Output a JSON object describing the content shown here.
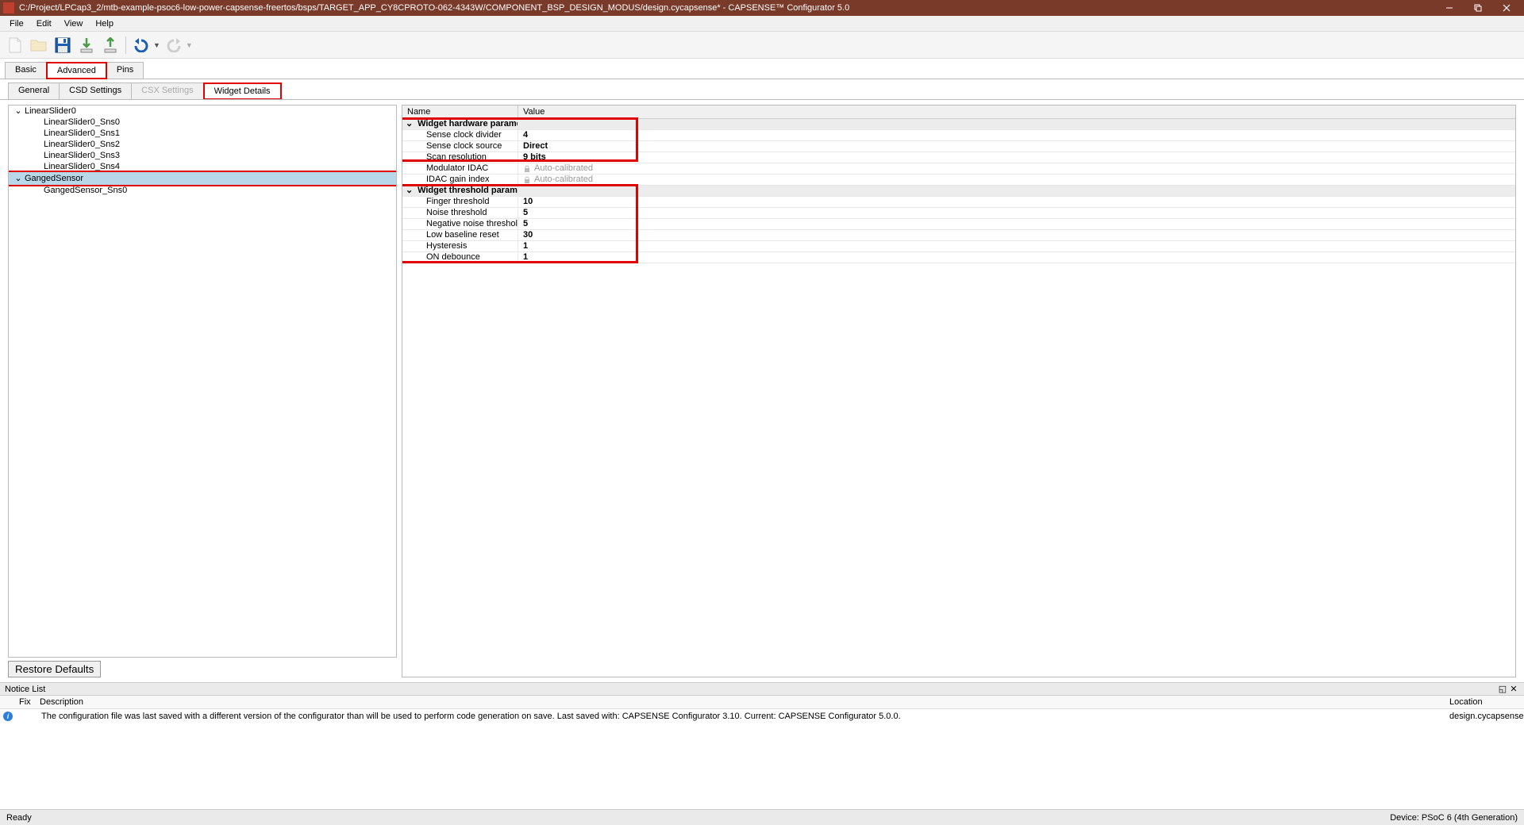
{
  "titlebar": {
    "path": "C:/Project/LPCap3_2/mtb-example-psoc6-low-power-capsense-freertos/bsps/TARGET_APP_CY8CPROTO-062-4343W/COMPONENT_BSP_DESIGN_MODUS/design.cycapsense* - CAPSENSE™ Configurator 5.0"
  },
  "menus": [
    "File",
    "Edit",
    "View",
    "Help"
  ],
  "main_tabs": {
    "items": [
      "Basic",
      "Advanced",
      "Pins"
    ],
    "active": 1,
    "highlight": 1
  },
  "sub_tabs": {
    "items": [
      "General",
      "CSD Settings",
      "CSX Settings",
      "Widget Details"
    ],
    "active": 3,
    "highlight": 3,
    "disabled": [
      2
    ]
  },
  "tree": {
    "nodes": [
      {
        "label": "LinearSlider0",
        "children": [
          "LinearSlider0_Sns0",
          "LinearSlider0_Sns1",
          "LinearSlider0_Sns2",
          "LinearSlider0_Sns3",
          "LinearSlider0_Sns4"
        ]
      },
      {
        "label": "GangedSensor",
        "selected": true,
        "children": [
          "GangedSensor_Sns0"
        ]
      }
    ]
  },
  "restore_label": "Restore Defaults",
  "param_header": {
    "name": "Name",
    "value": "Value"
  },
  "groups": [
    {
      "title": "Widget hardware parameters",
      "highlight": "top3",
      "rows": [
        {
          "name": "Sense clock divider",
          "value": "4",
          "bold": true
        },
        {
          "name": "Sense clock source",
          "value": "Direct",
          "bold": true
        },
        {
          "name": "Scan resolution",
          "value": "9 bits",
          "bold": true
        },
        {
          "name": "Modulator IDAC",
          "value": "Auto-calibrated",
          "muted": true,
          "lock": true
        },
        {
          "name": "IDAC gain index",
          "value": "Auto-calibrated",
          "muted": true,
          "lock": true
        }
      ]
    },
    {
      "title": "Widget threshold parameters",
      "highlight": "all",
      "rows": [
        {
          "name": "Finger threshold",
          "value": "10",
          "bold": true
        },
        {
          "name": "Noise threshold",
          "value": "5",
          "bold": true
        },
        {
          "name": "Negative noise threshold",
          "value": "5",
          "bold": true
        },
        {
          "name": "Low baseline reset",
          "value": "30",
          "bold": true
        },
        {
          "name": "Hysteresis",
          "value": "1",
          "bold": true
        },
        {
          "name": "ON debounce",
          "value": "1",
          "bold": true
        }
      ]
    }
  ],
  "notice": {
    "title": "Notice List",
    "cols": {
      "fix": "Fix",
      "desc": "Description",
      "loc": "Location"
    },
    "rows": [
      {
        "type": "info",
        "desc": "The configuration file was last saved with a different version of the configurator than will be used to perform code generation on save. Last saved with: CAPSENSE Configurator 3.10. Current: CAPSENSE Configurator 5.0.0.",
        "loc": "design.cycapsense"
      }
    ]
  },
  "status": {
    "left": "Ready",
    "right": "Device: PSoC 6 (4th Generation)"
  }
}
